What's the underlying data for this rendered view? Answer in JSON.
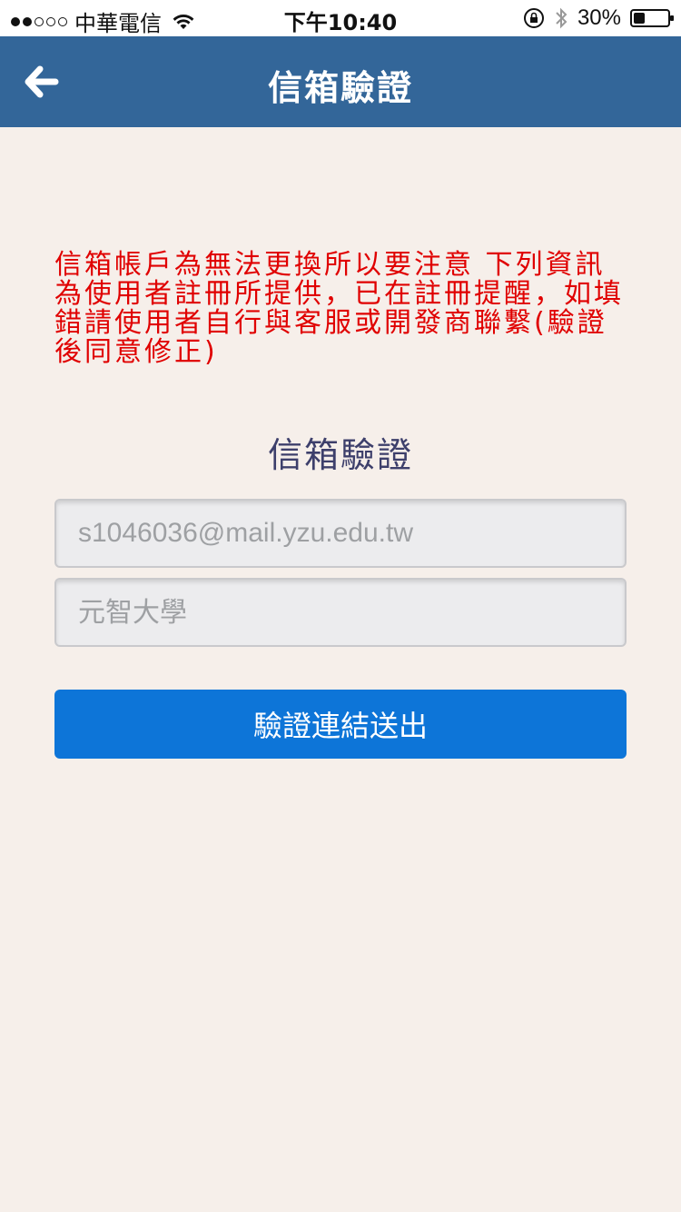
{
  "status_bar": {
    "carrier": "中華電信",
    "time": "下午10:40",
    "battery_percent": "30%",
    "battery_level": 0.3,
    "icons": [
      "signal-dots",
      "wifi-icon",
      "orientation-lock-icon",
      "bluetooth-icon",
      "battery-icon"
    ]
  },
  "nav": {
    "title": "信箱驗證",
    "back_icon": "back-arrow-icon",
    "background_color": "#336699"
  },
  "notice": {
    "text": "信箱帳戶為無法更換所以要注意 下列資訊為使用者註冊所提供，已在註冊提醒，如填錯請使用者自行與客服或開發商聯繫(驗證後同意修正)",
    "color": "#e00000"
  },
  "form": {
    "title": "信箱驗證",
    "email_placeholder": "s1046036@mail.yzu.edu.tw",
    "school_placeholder": "元智大學",
    "submit_label": "驗證連結送出",
    "submit_color": "#0d75d8"
  },
  "colors": {
    "page_background": "#f6efea",
    "title_text": "#3d3f6b"
  }
}
